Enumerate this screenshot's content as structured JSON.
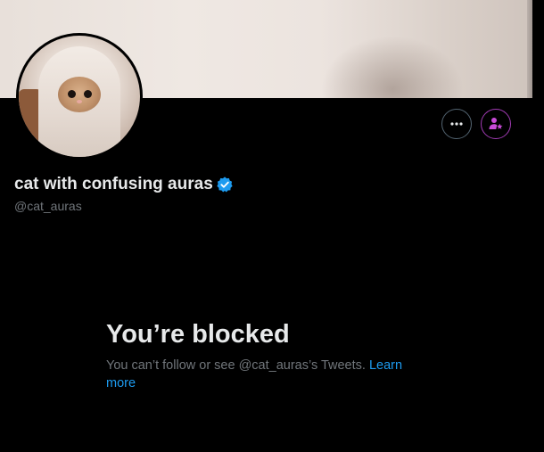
{
  "profile": {
    "display_name": "cat with confusing auras",
    "handle": "@cat_auras",
    "verified": true,
    "verified_color": "#1d9bf0"
  },
  "actions": {
    "more_icon": "more-horizontal-icon",
    "subscribe_icon": "person-star-icon",
    "subscribe_color": "#c94bd8"
  },
  "blocked": {
    "title": "You’re blocked",
    "description": "You can’t follow or see @cat_auras’s Tweets.",
    "link_label": "Learn more",
    "link_color": "#1d9bf0"
  },
  "colors": {
    "background": "#000000",
    "primary_text": "#e7e9ea",
    "secondary_text": "#71767b"
  }
}
